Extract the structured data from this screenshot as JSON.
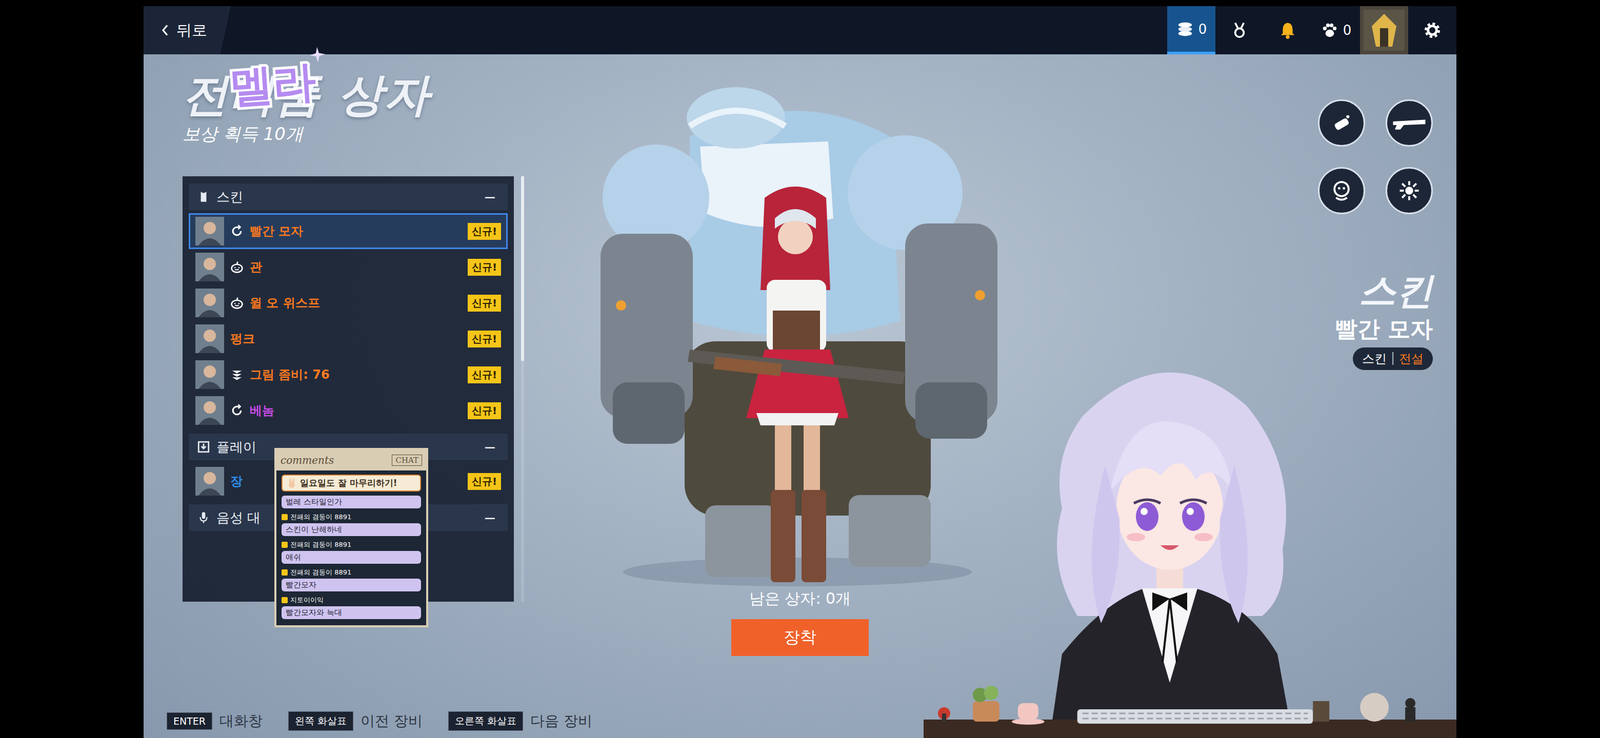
{
  "top_bar": {
    "back": "뒤로",
    "wallet": {
      "count": "0",
      "selected": true
    },
    "pets": {
      "count": "0"
    },
    "notifications": {
      "unread": true
    }
  },
  "streamer_logo": "멜라",
  "title": "전리품 상자",
  "subtitle": "보상 획득 10개",
  "sections": [
    {
      "title": "스킨",
      "kind": "skin",
      "toggle": "−",
      "expanded": true,
      "items": [
        {
          "name": "빨간 모자",
          "kind": "limited",
          "badge": "신규!",
          "color": "#ff7a1e",
          "selected": true
        },
        {
          "name": "관",
          "kind": "halloween",
          "badge": "신규!",
          "color": "#ff7a1e",
          "selected": false
        },
        {
          "name": "윌 오 위스프",
          "kind": "halloween",
          "badge": "신규!",
          "color": "#ff7a1e",
          "selected": false
        },
        {
          "name": "펑크",
          "kind": "none",
          "badge": "신규!",
          "color": "#ff7a1e",
          "selected": false
        },
        {
          "name": "그림 좀비: 76",
          "kind": "battlepass",
          "badge": "신규!",
          "color": "#ff7a1e",
          "selected": false
        },
        {
          "name": "베놈",
          "kind": "limited",
          "badge": "신규!",
          "color": "#c94ce6",
          "selected": false
        }
      ]
    },
    {
      "title": "플레이",
      "kind": "icon",
      "toggle": "−",
      "expanded": true,
      "items": [
        {
          "name": "장",
          "kind": "none",
          "badge": "신규!",
          "color": "#2f8ef0",
          "selected": false
        }
      ]
    },
    {
      "title": "음성 대",
      "kind": "voice",
      "toggle": "−",
      "expanded": true,
      "items": []
    }
  ],
  "preview": {
    "remaining": "남은 상자: 0개",
    "equip": "장착"
  },
  "info": {
    "category": "스킨",
    "name": "빨간 모자",
    "type": "스킨",
    "separator": "|",
    "rarity": "전설"
  },
  "hints": [
    {
      "key": "ENTER",
      "label": "대화창"
    },
    {
      "key": "왼쪽 화살표",
      "label": "이전 장비"
    },
    {
      "key": "오른쪽 화살표",
      "label": "다음 장비"
    }
  ],
  "chat": {
    "title": "comments",
    "tag": "CHAT",
    "notice": "일요일도 잘 마무리하기!",
    "messages": [
      {
        "text": "벌레 스타일인가"
      },
      {
        "user": "전패의 겸둥이 8891",
        "text": "스킨이 난해하네"
      },
      {
        "user": "전패의 겸둥이 8891",
        "text": "애쉬"
      },
      {
        "user": "전패의 겸둥이 8891",
        "text": "빨간모자"
      },
      {
        "user": "지토이이익",
        "text": "빨간모자와 늑대"
      }
    ]
  }
}
